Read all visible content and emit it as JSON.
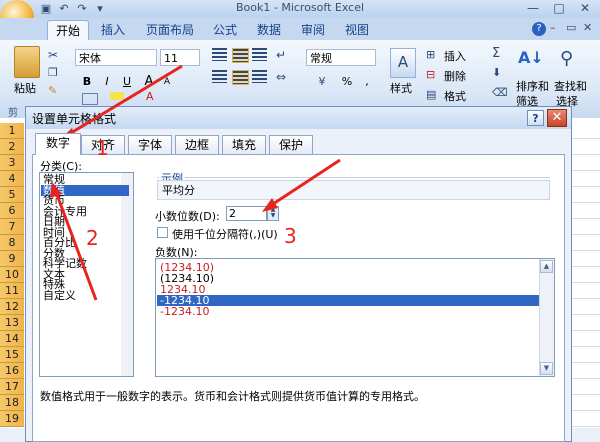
{
  "window": {
    "title": "Book1 - Microsoft Excel",
    "minimize": "—",
    "maximize": "□",
    "close": "✕"
  },
  "ribbon": {
    "tabs": [
      "开始",
      "插入",
      "页面布局",
      "公式",
      "数据",
      "审阅",
      "视图"
    ],
    "active_tab": "开始",
    "clipboard": {
      "paste": "粘贴",
      "group": "剪"
    },
    "font": {
      "name": "宋体",
      "size": "11",
      "bold": "B",
      "italic": "I",
      "underline": "U",
      "grow": "A",
      "shrink": "A"
    },
    "number": {
      "format": "常规",
      "percent": "%",
      "comma": ","
    },
    "styles": {
      "label": "样式"
    },
    "cells": {
      "insert": "插入",
      "delete": "删除",
      "format": "格式"
    },
    "editing": {
      "sort": "排序和",
      "sort2": "筛选",
      "find": "查找和",
      "find2": "选择",
      "sum": "Σ"
    }
  },
  "sheet": {
    "rows": [
      "1",
      "2",
      "3",
      "4",
      "5",
      "6",
      "7",
      "8",
      "9",
      "10",
      "11",
      "12",
      "13",
      "14",
      "15",
      "16",
      "17",
      "18",
      "19"
    ]
  },
  "dialog": {
    "title": "设置单元格格式",
    "help": "?",
    "close": "✕",
    "tabs": [
      "数字",
      "对齐",
      "字体",
      "边框",
      "填充",
      "保护"
    ],
    "active_tab": "数字",
    "category_label": "分类(C):",
    "categories": [
      "常规",
      "数值",
      "货币",
      "会计专用",
      "日期",
      "时间",
      "百分比",
      "分数",
      "科学记数",
      "文本",
      "特殊",
      "自定义"
    ],
    "selected_category": "数值",
    "sample_label": "示例",
    "sample_value": "平均分",
    "decimal_label": "小数位数(D):",
    "decimal_value": "2",
    "thousands_label": "使用千位分隔符(,)(U)",
    "negative_label": "负数(N):",
    "negative_options": [
      "(1234.10)",
      "(1234.10)",
      "1234.10",
      "-1234.10",
      "-1234.10"
    ],
    "selected_negative": "-1234.10",
    "description": "数值格式用于一般数字的表示。货币和会计格式则提供货币值计算的专用格式。"
  },
  "annotations": {
    "labels": [
      "1",
      "2",
      "3"
    ],
    "color": "#e7251e"
  },
  "colors": {
    "selection": "#3167c4",
    "negative_red": "#c81e1e",
    "row_header": "#f0b34a"
  }
}
